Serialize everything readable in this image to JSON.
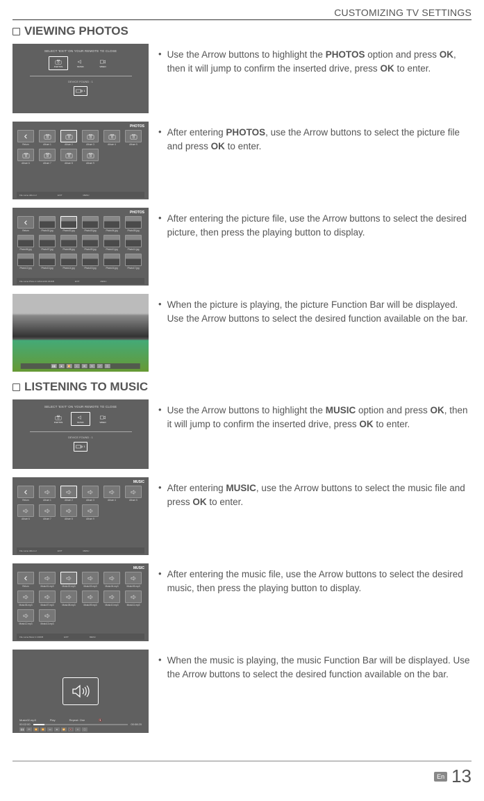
{
  "header": {
    "title": "CUSTOMIZING TV SETTINGS"
  },
  "photos": {
    "heading": "VIEWING PHOTOS",
    "menu": {
      "caption": "SELECT 'EXIT' ON YOUR REMOTE TO CLOSE",
      "tabs": {
        "photos": "PHOTOS",
        "music": "MUSIC",
        "video": "VIDEO"
      },
      "device_line": "DEVICE FOUND : 1",
      "usb_label": "1"
    },
    "albums": {
      "title": "PHOTOS",
      "items": [
        "Return",
        "Album 1",
        "Album 2",
        "Album 3",
        "Album 4",
        "Album 5",
        "Album 6",
        "Album 7",
        "Album 8",
        "Album 9"
      ],
      "footer_left": "File name\nAlbum 2",
      "footer_keys": [
        "EXIT",
        "MENU"
      ]
    },
    "thumbs": {
      "title": "PHOTOS",
      "items": [
        "Return",
        "Photo01.jpg",
        "Photo02.jpg",
        "Photo03.jpg",
        "Photo04.jpg",
        "Photo05.jpg",
        "Photo06.jpg",
        "Photo07.jpg",
        "Photo08.jpg",
        "Photo09.jpg",
        "Photo10.jpg",
        "Photo11.jpg",
        "Photo12.jpg",
        "Photo13.jpg",
        "Photo14.jpg",
        "Photo15.jpg",
        "Photo16.jpg",
        "Photo17.jpg"
      ],
      "footer_left": "File name:Photo 2\n1234x1234   234KB",
      "footer_keys": [
        "EXIT",
        "MENU"
      ]
    },
    "steps": [
      "Use the Arrow buttons to highlight the <b>PHOTOS</b> option and press <b>OK</b>, then it will jump to confirm the inserted drive, press <b>OK</b> to enter.",
      "After entering <b>PHOTOS</b>, use the Arrow buttons to select the picture file and press <b>OK</b> to enter.",
      "After entering the picture file, use the Arrow buttons to select the desired picture, then press the playing button to display.",
      "When the picture is playing, the picture Function Bar will be displayed. Use the Arrow buttons to select the desired function available on the bar."
    ]
  },
  "music": {
    "heading": "LISTENING TO MUSIC",
    "menu": {
      "caption": "SELECT 'EXIT' ON YOUR REMOTE TO CLOSE",
      "tabs": {
        "photos": "PHOTOS",
        "music": "MUSIC",
        "video": "VIDEO"
      },
      "device_line": "DEVICE FOUND : 1",
      "usb_label": "1"
    },
    "albums": {
      "title": "MUSIC",
      "items": [
        "Return",
        "Album 1",
        "Album 2",
        "Album 3",
        "Album 4",
        "Album 5",
        "Album 6",
        "Album 7",
        "Album 8",
        "Album 9"
      ],
      "footer_left": "File name\nAlbum 2",
      "footer_keys": [
        "EXIT",
        "MENU"
      ]
    },
    "tracks": {
      "title": "MUSIC",
      "items": [
        "Return",
        "Music01.mp3",
        "Music02.mp3",
        "Music03.mp3",
        "Music04.mp3",
        "Music05.mp3",
        "Music06.mp3",
        "Music07.mp3",
        "Music08.mp3",
        "Music09.mp3",
        "Music10.mp3",
        "Music11.mp3",
        "Music12.mp3",
        "Music13.mp3"
      ],
      "footer_left": "File name:Music 2\n234KB",
      "footer_keys": [
        "EXIT",
        "MENU"
      ]
    },
    "player": {
      "track_name": "Music02.mp3",
      "status": "Play",
      "repeat": "Repeat: One",
      "elapsed": "00:02:00",
      "total": "00:08:20"
    },
    "steps": [
      "Use the Arrow buttons to highlight the <b>MUSIC</b> option and press <b>OK</b>, then it will jump to confirm the inserted drive, press <b>OK</b> to enter.",
      "After entering <b>MUSIC</b>, use the Arrow buttons to select the music file and press <b>OK</b> to enter.",
      "After entering the music file, use the Arrow buttons to select the desired music, then press the playing button to display.",
      "When the music is playing, the music Function Bar will be displayed. Use the Arrow buttons to select the desired function available on the bar."
    ]
  },
  "footer": {
    "lang": "En",
    "page": "13"
  }
}
